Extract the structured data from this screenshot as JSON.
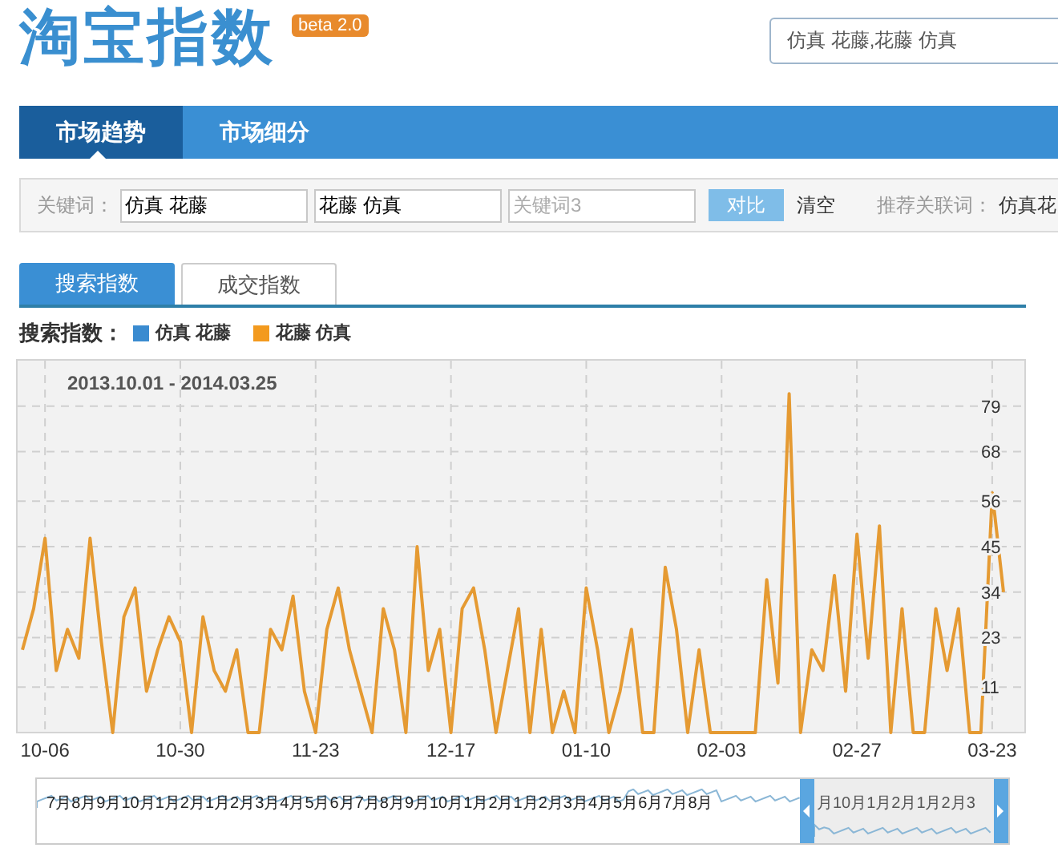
{
  "header": {
    "logo": "淘宝指数",
    "badge": "beta 2.0",
    "search": {
      "value": "仿真 花藤,花藤 仿真"
    }
  },
  "nav_tabs": [
    {
      "label": "市场趋势",
      "selected": true
    },
    {
      "label": "市场细分",
      "selected": false
    }
  ],
  "keyword_bar": {
    "label": "关键词：",
    "fields": [
      {
        "value": "仿真 花藤"
      },
      {
        "value": "花藤 仿真"
      },
      {
        "placeholder": "关键词3"
      }
    ],
    "compare_button": "对比",
    "clear_link": "清空",
    "related_label": "推荐关联词：",
    "related_value": "仿真花"
  },
  "index_tabs": [
    {
      "label": "搜索指数",
      "selected": true
    },
    {
      "label": "成交指数",
      "selected": false
    }
  ],
  "legend": {
    "label": "搜索指数：",
    "items": [
      {
        "name": "仿真 花藤",
        "color": "#3a8bd0"
      },
      {
        "name": "花藤 仿真",
        "color": "#f39a1e"
      }
    ]
  },
  "chart": {
    "date_range": "2013.10.01 - 2014.03.25",
    "chart_data": {
      "type": "line",
      "categories": [
        null,
        null,
        "10-06",
        null,
        null,
        null,
        null,
        null,
        null,
        null,
        null,
        null,
        null,
        null,
        "10-30",
        null,
        null,
        null,
        null,
        null,
        null,
        null,
        null,
        null,
        null,
        null,
        "11-23",
        null,
        null,
        null,
        null,
        null,
        null,
        null,
        null,
        null,
        null,
        null,
        "12-17",
        null,
        null,
        null,
        null,
        null,
        null,
        null,
        null,
        null,
        null,
        null,
        "01-10",
        null,
        null,
        null,
        null,
        null,
        null,
        null,
        null,
        null,
        null,
        null,
        "02-03",
        null,
        null,
        null,
        null,
        null,
        null,
        null,
        null,
        null,
        null,
        null,
        "02-27",
        null,
        null,
        null,
        null,
        null,
        null,
        null,
        null,
        null,
        null,
        null,
        "03-23",
        null
      ],
      "series": [
        {
          "color": "#e59a32",
          "values": [
            20,
            30,
            47,
            15,
            25,
            18,
            47,
            22,
            0,
            28,
            35,
            10,
            20,
            28,
            22,
            0,
            28,
            15,
            10,
            20,
            0,
            0,
            25,
            20,
            33,
            10,
            0,
            25,
            35,
            20,
            10,
            0,
            30,
            20,
            0,
            45,
            15,
            25,
            0,
            30,
            35,
            20,
            0,
            15,
            30,
            0,
            25,
            0,
            10,
            0,
            35,
            20,
            0,
            10,
            25,
            0,
            0,
            40,
            25,
            0,
            20,
            0,
            0,
            0,
            0,
            0,
            37,
            12,
            82,
            0,
            20,
            15,
            38,
            10,
            48,
            18,
            50,
            0,
            30,
            0,
            0,
            30,
            15,
            30,
            0,
            0,
            58,
            34
          ]
        }
      ],
      "ylim": [
        0,
        90
      ],
      "grid": true,
      "yticks": [
        11,
        23,
        34,
        45,
        56,
        68,
        79
      ]
    }
  },
  "navigator": {
    "labels": [
      "7月",
      "8月",
      "9月",
      "10月",
      "1月",
      "2月",
      "1月",
      "2月",
      "3月",
      "4月",
      "5月",
      "6月",
      "7月",
      "8月",
      "9月",
      "10月",
      "1月",
      "2月",
      "1月",
      "2月",
      "3月",
      "4月",
      "5月",
      "6月",
      "7月",
      "8月"
    ],
    "selected_labels": [
      "月",
      "10月",
      "1月",
      "2月",
      "1月",
      "2月",
      "3"
    ]
  }
}
